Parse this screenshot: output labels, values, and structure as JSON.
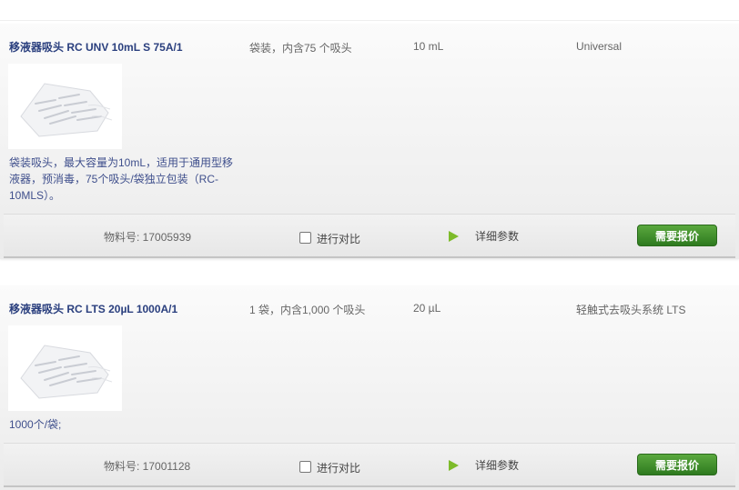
{
  "products": [
    {
      "title": "移液器吸头 RC UNV 10mL S 75A/1",
      "packaging": "袋装，内含75 个吸头",
      "volume": "10 mL",
      "system": "Universal",
      "description": "袋装吸头，最大容量为10mL，适用于通用型移液器，预消毒，75个吸头/袋独立包装（RC-10MLS）。",
      "part_number": "物料号: 17005939",
      "compare_label": "进行对比",
      "details_label": "详细参数",
      "quote_label": "需要报价"
    },
    {
      "title": "移液器吸头 RC LTS 20µL 1000A/1",
      "packaging": "1 袋，内含1,000 个吸头",
      "volume": "20 µL",
      "system": "轻触式去吸头系统 LTS",
      "description": "1000个/袋;",
      "part_number": "物料号: 17001128",
      "compare_label": "进行对比",
      "details_label": "详细参数",
      "quote_label": "需要报价"
    }
  ],
  "icons": {
    "thumbnail": "pipette-tips-bag-image",
    "details": "play-triangle-icon",
    "compare": "checkbox"
  },
  "colors": {
    "title": "#2a3f7e",
    "description": "#3f4f8c",
    "accent_green": "#7dbb2a",
    "button_green": "#3f8f2a"
  }
}
